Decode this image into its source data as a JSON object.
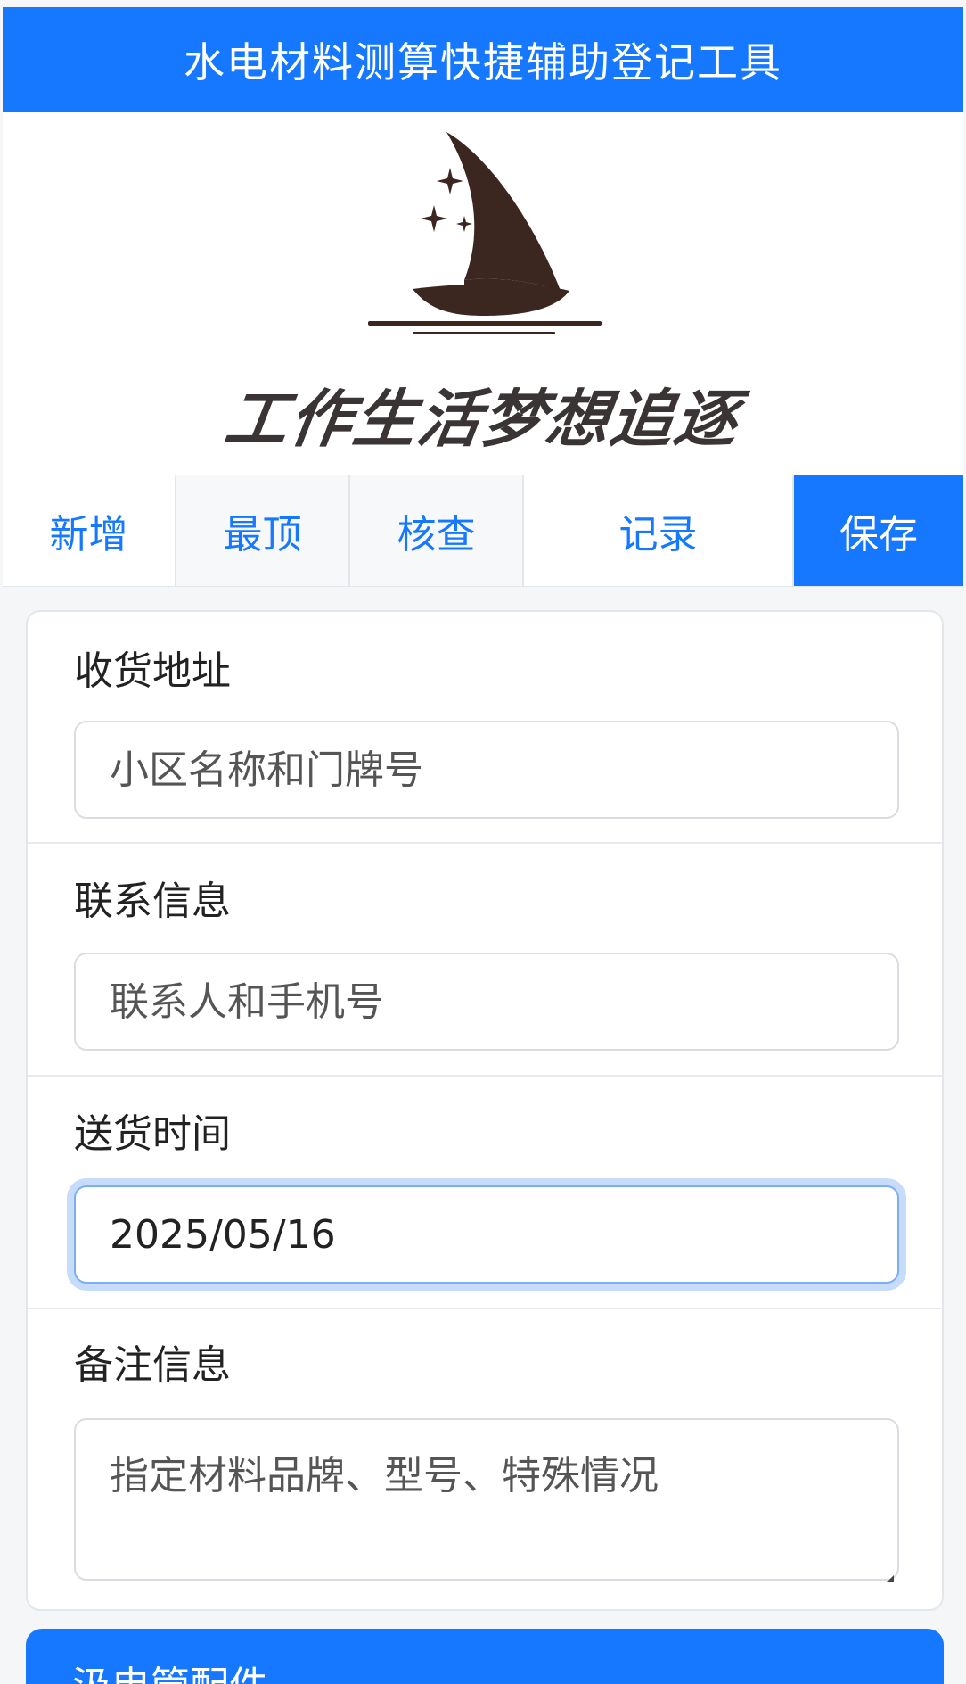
{
  "app": {
    "title": "水电材料测算快捷辅助登记工具"
  },
  "banner": {
    "slogan": "工作生活梦想追逐",
    "icon": "sailboat-logo",
    "logo_color": "#3b2620"
  },
  "tabs": [
    {
      "label": "新增"
    },
    {
      "label": "最顶"
    },
    {
      "label": "核查"
    },
    {
      "label": "记录"
    },
    {
      "label": "保存",
      "active": true
    }
  ],
  "form": {
    "address": {
      "label": "收货地址",
      "placeholder": "小区名称和门牌号",
      "value": ""
    },
    "contact": {
      "label": "联系信息",
      "placeholder": "联系人和手机号",
      "value": ""
    },
    "delivery_time": {
      "label": "送货时间",
      "value": "2025/05/16"
    },
    "notes": {
      "label": "备注信息",
      "placeholder": "指定材料品牌、型号、特殊情况",
      "value": ""
    }
  },
  "bottom_button": {
    "label": "汲电管配件"
  },
  "colors": {
    "accent": "#1677ff",
    "focus_ring": "#c7dcfb"
  }
}
